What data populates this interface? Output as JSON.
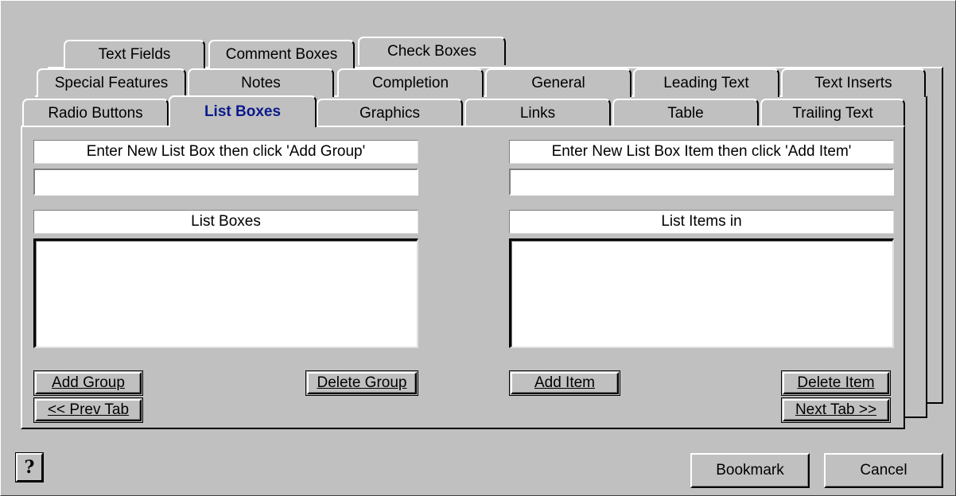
{
  "tabs": {
    "row3": [
      "Text Fields",
      "Comment Boxes",
      "Check Boxes"
    ],
    "row2": [
      "Special Features",
      "Notes",
      "Completion",
      "General",
      "Leading Text",
      "Text Inserts"
    ],
    "row1": [
      "Radio Buttons",
      "List Boxes",
      "Graphics",
      "Links",
      "Table",
      "Trailing Text"
    ],
    "active": "List Boxes"
  },
  "left": {
    "prompt": "Enter New List Box then click 'Add Group'",
    "input_value": "",
    "list_header": "List Boxes",
    "items": [],
    "add_button": "Add Group",
    "delete_button": "Delete Group",
    "prev_button": "<< Prev Tab"
  },
  "right": {
    "prompt": "Enter New List Box Item then click 'Add Item'",
    "input_value": "",
    "list_header": "List Items in",
    "items": [],
    "add_button": "Add Item",
    "delete_button": "Delete Item",
    "next_button": "Next Tab >>"
  },
  "footer": {
    "help_icon": "?",
    "bookmark_button": "Bookmark",
    "cancel_button": "Cancel"
  },
  "colors": {
    "face": "#c0c0c0",
    "active_tab_text": "#0a1a8c"
  }
}
